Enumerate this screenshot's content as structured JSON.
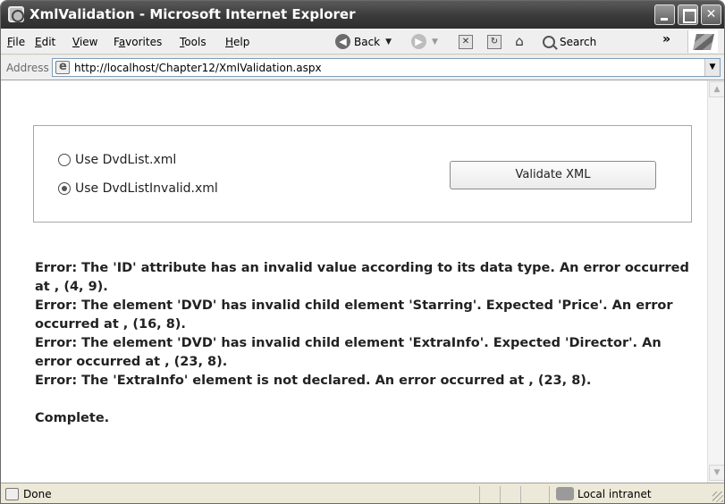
{
  "window": {
    "title": "XmlValidation - Microsoft Internet Explorer"
  },
  "menu": {
    "items": [
      {
        "underline": "F",
        "rest": "ile"
      },
      {
        "underline": "E",
        "rest": "dit"
      },
      {
        "underline": "V",
        "rest": "iew"
      },
      {
        "prefix": "F",
        "underline": "a",
        "rest": "vorites"
      },
      {
        "underline": "T",
        "rest": "ools"
      },
      {
        "underline": "H",
        "rest": "elp"
      }
    ],
    "back_label": "Back",
    "search_label": "Search",
    "more_label": "»"
  },
  "address": {
    "label": "Address",
    "url": "http://localhost/Chapter12/XmlValidation.aspx"
  },
  "form": {
    "radio1_label": "Use DvdList.xml",
    "radio2_label": "Use DvdListInvalid.xml",
    "selected_option": "radio2",
    "validate_button": "Validate XML"
  },
  "results": {
    "lines": [
      "Error: The 'ID' attribute has an invalid value according to its data type. An error occurred at , (4, 9).",
      "Error: The element 'DVD' has invalid child element 'Starring'. Expected 'Price'. An error occurred at , (16, 8).",
      "Error: The element 'DVD' has invalid child element 'ExtraInfo'. Expected 'Director'. An error occurred at , (23, 8).",
      "Error: The 'ExtraInfo' element is not declared. An error occurred at , (23, 8)."
    ],
    "complete": "Complete."
  },
  "status": {
    "text": "Done",
    "zone": "Local intranet"
  }
}
